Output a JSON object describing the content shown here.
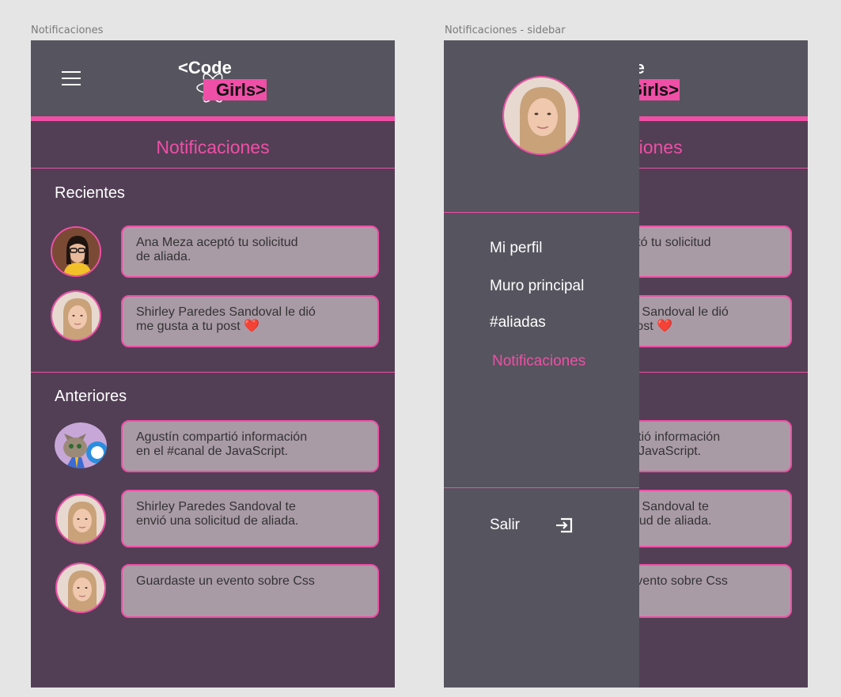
{
  "frames": {
    "left_label": "Notificaciones",
    "right_label": "Notificaciones - sidebar"
  },
  "logo": {
    "code": "<Code",
    "girls": "Girls>"
  },
  "header": {
    "title": "Notificaciones",
    "menu_icon": "hamburger-icon"
  },
  "sections": {
    "recent_title": "Recientes",
    "older_title": "Anteriores"
  },
  "notifications": {
    "recent": [
      {
        "text": "Ana Meza aceptó tu solicitud\nde aliada.",
        "avatar": "woman-glasses-avatar"
      },
      {
        "text": "Shirley Paredes Sandoval  le dió\nme gusta a tu post ",
        "avatar": "blonde-woman-avatar",
        "emoji": "❤️"
      }
    ],
    "older": [
      {
        "text": "Agustín compartió información\nen el  #canal de JavaScript.",
        "avatar": "cat-avatar"
      },
      {
        "text": "Shirley Paredes Sandoval te\nenvió una solicitud de aliada.",
        "avatar": "blonde-woman-avatar"
      },
      {
        "text": "Guardaste un evento sobre Css",
        "avatar": "blonde-woman-avatar"
      }
    ]
  },
  "sidebar": {
    "items": [
      {
        "label": "Mi perfil"
      },
      {
        "label": "Muro principal"
      },
      {
        "label": "#aliadas"
      },
      {
        "label": "Notificaciones",
        "active": true
      }
    ],
    "logout_label": "Salir",
    "logout_icon": "exit-icon"
  },
  "colors": {
    "accent": "#ef4fa6",
    "background": "#523f55",
    "topbar": "#56545e",
    "bubble": "#a99ba6"
  }
}
